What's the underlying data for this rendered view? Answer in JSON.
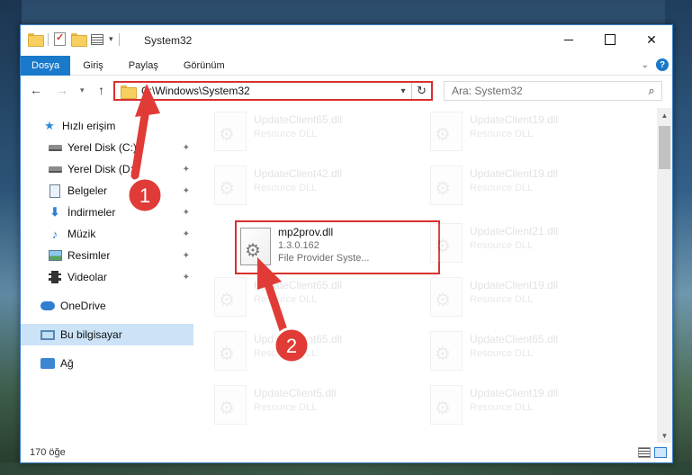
{
  "window": {
    "title": "System32",
    "controls": {
      "minimize": "",
      "maximize": "",
      "close": "✕"
    }
  },
  "ribbon": {
    "tabs": [
      "Dosya",
      "Giriş",
      "Paylaş",
      "Görünüm"
    ],
    "help_icon": "question-mark",
    "help_label": "?"
  },
  "navbar": {
    "back_icon": "←",
    "forward_icon": "→",
    "recent_icon": "▾",
    "up_icon": "↑",
    "address_path": "C:\\Windows\\System32",
    "address_dropdown": "▾",
    "refresh_icon": "↻",
    "search_placeholder": "Ara: System32",
    "search_icon": "⌕"
  },
  "sidebar": {
    "items": [
      {
        "label": "Hızlı erişim",
        "icon": "star-icon",
        "glyph": "★",
        "pinned": false
      },
      {
        "label": "Yerel Disk (C:)",
        "icon": "drive-icon",
        "pinned": true
      },
      {
        "label": "Yerel Disk (D:)",
        "icon": "drive-icon",
        "pinned": true
      },
      {
        "label": "Belgeler",
        "icon": "documents-icon",
        "pinned": true
      },
      {
        "label": "İndirmeler",
        "icon": "downloads-icon",
        "glyph": "⬇",
        "pinned": true
      },
      {
        "label": "Müzik",
        "icon": "music-icon",
        "glyph": "♪",
        "pinned": true
      },
      {
        "label": "Resimler",
        "icon": "pictures-icon",
        "pinned": true
      },
      {
        "label": "Videolar",
        "icon": "videos-icon",
        "pinned": true
      },
      {
        "label": "OneDrive",
        "icon": "onedrive-icon",
        "pinned": false
      },
      {
        "label": "Bu bilgisayar",
        "icon": "this-pc-icon",
        "pinned": false,
        "selected": true
      },
      {
        "label": "Ağ",
        "icon": "network-icon",
        "pinned": false
      }
    ],
    "pin_glyph": "📌"
  },
  "files": [
    {
      "name": "UpdateClient65.dll",
      "desc": "Resource DLL"
    },
    {
      "name": "UpdateClient19.dll",
      "desc": "Resource DLL"
    },
    {
      "name": "UpdateClient42.dll",
      "desc": "Resource DLL"
    },
    {
      "name": "UpdateClient19.dll",
      "desc": "Resource DLL"
    },
    {
      "name": "mp2prov.dll",
      "version": "1.3.0.162",
      "desc": "File Provider Syste...",
      "highlight": true
    },
    {
      "name": "UpdateClient21.dll",
      "desc": "Resource DLL"
    },
    {
      "name": "UpdateClient65.dll",
      "desc": "Resource DLL"
    },
    {
      "name": "UpdateClient19.dll",
      "desc": "Resource DLL"
    },
    {
      "name": "UpdateClient65.dll",
      "desc": "Resource DLL"
    },
    {
      "name": "UpdateClient65.dll",
      "desc": "Resource DLL"
    },
    {
      "name": "UpdateClient5.dll",
      "desc": "Resource DLL"
    },
    {
      "name": "UpdateClient19.dll",
      "desc": "Resource DLL"
    }
  ],
  "status": {
    "item_count": "170 öğe"
  },
  "annotations": [
    {
      "label": "1",
      "color": "#e03b36"
    },
    {
      "label": "2",
      "color": "#e03b36"
    }
  ],
  "colors": {
    "accent": "#1979ca",
    "highlight_box": "#d9302f",
    "selected_bg": "#cce3f7"
  }
}
